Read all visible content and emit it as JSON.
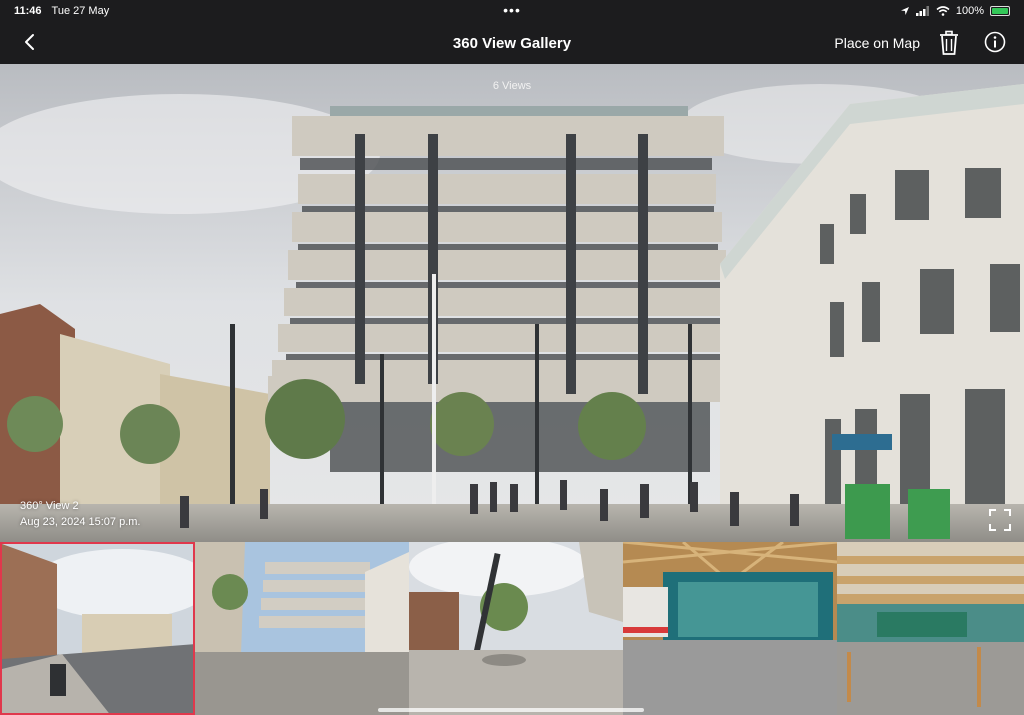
{
  "status": {
    "time": "11:46",
    "date": "Tue 27 May",
    "battery": "100%"
  },
  "nav": {
    "title": "360 View Gallery",
    "place_on_map": "Place on Map"
  },
  "viewer": {
    "views_count": "6 Views",
    "view_name": "360° View 2",
    "view_date": "Aug 23, 2024 15:07 p.m."
  },
  "thumbnails": [
    {
      "selected": true
    },
    {
      "selected": false
    },
    {
      "selected": false
    },
    {
      "selected": false
    },
    {
      "selected": false
    },
    {
      "selected": false
    }
  ],
  "colors": {
    "bar_bg": "#1c1c1e",
    "selected_border": "#e0384c",
    "battery": "#34c759"
  }
}
